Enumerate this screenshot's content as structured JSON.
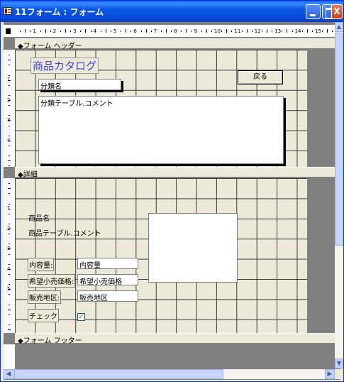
{
  "window": {
    "title": "11フォーム : フォーム",
    "buttons": {
      "minimize": "",
      "maximize": "",
      "close": "X"
    }
  },
  "ruler": {
    "horizontal_marks": [
      "1",
      "2",
      "3",
      "4",
      "5",
      "6",
      "7",
      "8",
      "9",
      "10",
      "11",
      "12",
      "13",
      "14",
      "15"
    ],
    "header_marks": [
      "1",
      "2",
      "3",
      "4"
    ],
    "detail_marks": [
      "1",
      "2",
      "3",
      "4",
      "5"
    ]
  },
  "sections": {
    "form_header": "フォーム ヘッダー",
    "detail": "詳細",
    "form_footer": "フォーム フッター"
  },
  "header_controls": {
    "title_label": "商品カタログ",
    "category_name_field": "分類名",
    "category_comment_field": "分類テーブル.コメント",
    "back_button": "戻る"
  },
  "detail_controls": {
    "product_name_label": "商品名",
    "product_comment_label": "商品テーブル.コメント",
    "capacity_label": "内容量:",
    "capacity_field": "内容量",
    "price_label": "希望小売価格:",
    "price_field": "希望小売価格",
    "region_label": "販売地区:",
    "region_field": "販売地区",
    "check_label": "チェック",
    "check_value": "✓"
  },
  "scrollbars": {
    "up": "▲",
    "down": "▼",
    "left": "◀",
    "right": "▶"
  },
  "colors": {
    "title_bar": "#0b58e4",
    "form_title_text": "#4040d0",
    "grid_background": "#ece9d8"
  }
}
